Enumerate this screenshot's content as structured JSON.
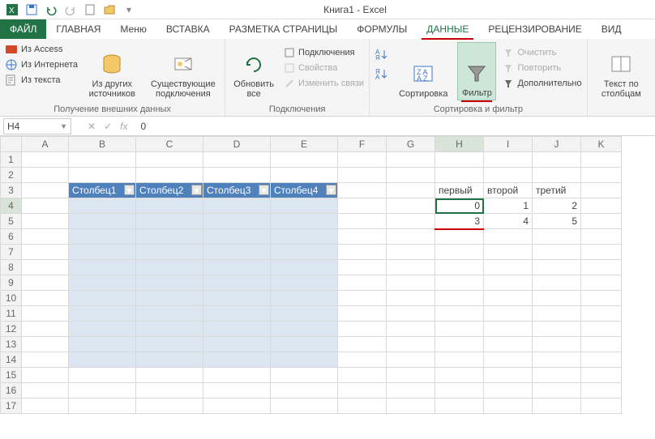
{
  "app": {
    "title": "Книга1 - Excel"
  },
  "qat": {
    "save": "save",
    "undo": "undo",
    "redo": "redo",
    "new": "new",
    "open": "open"
  },
  "tabs": {
    "file": "ФАЙЛ",
    "home": "ГЛАВНАЯ",
    "menu": "Меню",
    "insert": "ВСТАВКА",
    "pagelayout": "РАЗМЕТКА СТРАНИЦЫ",
    "formulas": "ФОРМУЛЫ",
    "data": "ДАННЫЕ",
    "review": "РЕЦЕНЗИРОВАНИЕ",
    "view": "ВИД"
  },
  "ribbon": {
    "getdata": {
      "access": "Из Access",
      "web": "Из Интернета",
      "text": "Из текста",
      "other": "Из других источников",
      "existing": "Существующие подключения",
      "group": "Получение внешних данных"
    },
    "connections": {
      "refresh": "Обновить все",
      "conn": "Подключения",
      "props": "Свойства",
      "editlinks": "Изменить связи",
      "group": "Подключения"
    },
    "sortfilter": {
      "sort": "Сортировка",
      "filter": "Фильтр",
      "clear": "Очистить",
      "reapply": "Повторить",
      "advanced": "Дополнительно",
      "group": "Сортировка и фильтр"
    },
    "texttocols": {
      "label": "Текст по столбцам"
    }
  },
  "formula": {
    "namebox": "H4",
    "value": "0"
  },
  "columns": [
    "A",
    "B",
    "C",
    "D",
    "E",
    "F",
    "G",
    "H",
    "I",
    "J",
    "K"
  ],
  "rows": [
    "1",
    "2",
    "3",
    "4",
    "5",
    "6",
    "7",
    "8",
    "9",
    "10",
    "11",
    "12",
    "13",
    "14",
    "15",
    "16",
    "17"
  ],
  "table": {
    "headers": [
      "Столбец1",
      "Столбец2",
      "Столбец3",
      "Столбец4"
    ]
  },
  "range2": {
    "headers": [
      "первый",
      "второй",
      "третий"
    ],
    "r1": [
      "0",
      "1",
      "2"
    ],
    "r2": [
      "3",
      "4",
      "5"
    ]
  }
}
